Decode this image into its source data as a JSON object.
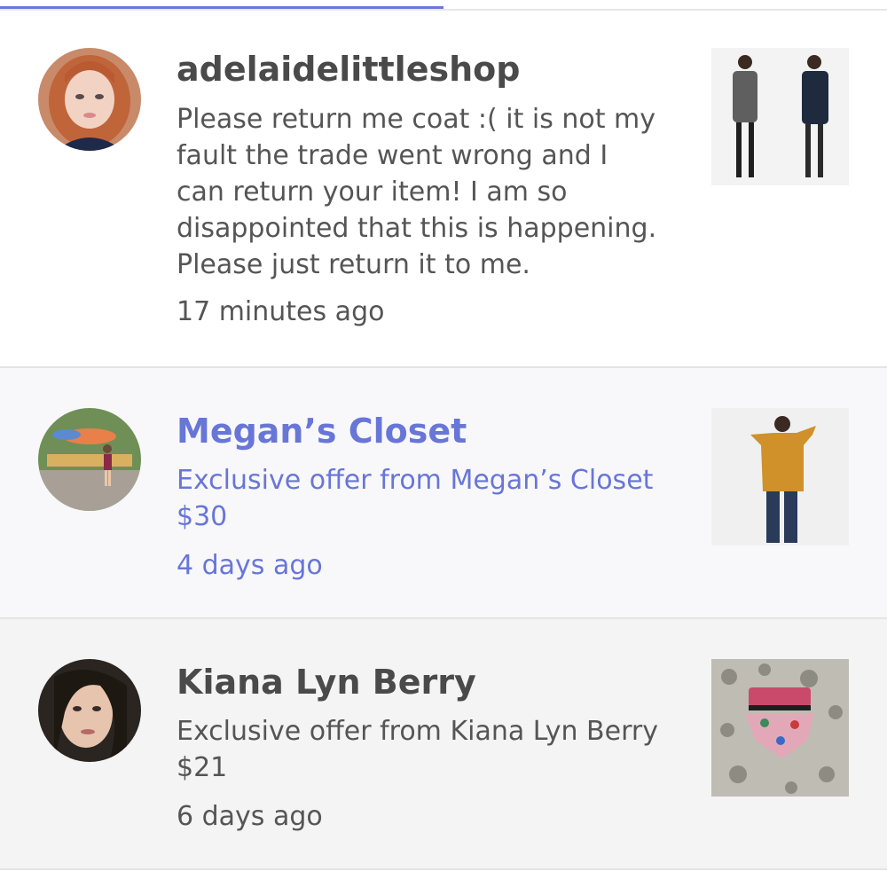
{
  "notifications": [
    {
      "name": "adelaidelittleshop",
      "message_lines": [
        "Please return me coat :( it is not my",
        "fault the trade went wrong and I",
        "can return your item! I am so",
        "disappointed that this is happening.",
        "Please just return it to me."
      ],
      "time": "17 minutes ago",
      "avatar_icon": "profile-photo",
      "thumbnail_icon": "coat-product-photo"
    },
    {
      "name": "Megan’s Closet",
      "message_lines": [
        "Exclusive offer from Megan’s Closet",
        "$30"
      ],
      "time": "4 days ago",
      "avatar_icon": "profile-photo",
      "thumbnail_icon": "sweater-product-photo",
      "accent_color": "#6876d8"
    },
    {
      "name": "Kiana Lyn Berry",
      "message_lines": [
        "Exclusive offer from Kiana Lyn Berry",
        "$21"
      ],
      "time": "6 days ago",
      "avatar_icon": "profile-photo",
      "thumbnail_icon": "swimsuit-product-photo"
    }
  ]
}
